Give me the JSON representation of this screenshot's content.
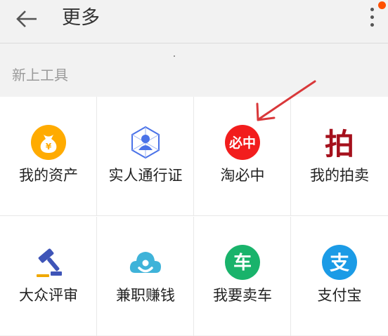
{
  "header": {
    "title": "更多",
    "back_icon": "back-arrow-icon",
    "more_icon": "more-vertical-icon",
    "badge_color": "#ff5000"
  },
  "section": {
    "title": "新上工具"
  },
  "tools": [
    {
      "label": "我的资产",
      "icon": "money-bag-icon",
      "color": "#ffab00"
    },
    {
      "label": "实人通行证",
      "icon": "person-badge-icon",
      "color": "#4a72e8"
    },
    {
      "label": "淘必中",
      "icon": "taobizhong-logo-icon",
      "color": "#f21d1d",
      "icon_text": "必中"
    },
    {
      "label": "我的拍卖",
      "icon": "auction-pai-icon",
      "color": "#a5101c",
      "icon_text": "拍"
    },
    {
      "label": "大众评审",
      "icon": "gavel-icon",
      "color": "#3f55b8"
    },
    {
      "label": "兼职赚钱",
      "icon": "cloud-person-icon",
      "color": "#3fb3d9"
    },
    {
      "label": "我要卖车",
      "icon": "car-sell-icon",
      "color": "#19b36b",
      "icon_text": "车"
    },
    {
      "label": "支付宝",
      "icon": "alipay-icon",
      "color": "#1b9be6",
      "icon_text": "支"
    }
  ],
  "annotation": {
    "arrow_color": "#d9383a"
  }
}
